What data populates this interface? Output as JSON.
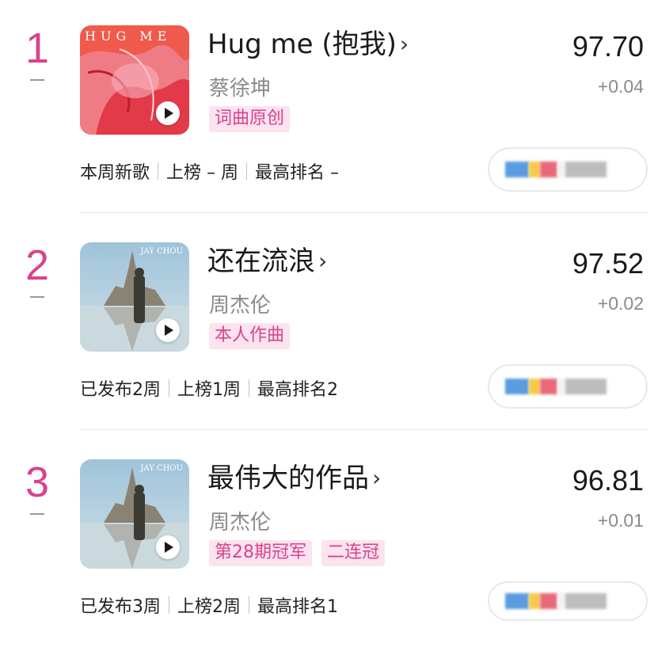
{
  "entries": [
    {
      "rank": "1",
      "title": "Hug me (抱我)",
      "artist": "蔡徐坤",
      "tags": [
        "词曲原创"
      ],
      "score": "97.70",
      "delta": "+0.04",
      "meta": [
        "本周新歌",
        "上榜 – 周",
        "最高排名 –"
      ],
      "cover_text": "HUG ME",
      "cover_icon": "hug-me-cover-art"
    },
    {
      "rank": "2",
      "title": "还在流浪",
      "artist": "周杰伦",
      "tags": [
        "本人作曲"
      ],
      "score": "97.52",
      "delta": "+0.02",
      "meta": [
        "已发布2周",
        "上榜1周",
        "最高排名2"
      ],
      "cover_text": "JAY CHOU",
      "cover_icon": "greatest-works-cover-art"
    },
    {
      "rank": "3",
      "title": "最伟大的作品",
      "artist": "周杰伦",
      "tags": [
        "第28期冠军",
        "二连冠"
      ],
      "score": "96.81",
      "delta": "+0.01",
      "meta": [
        "已发布3周",
        "上榜2周",
        "最高排名1"
      ],
      "cover_text": "JAY CHOU",
      "cover_icon": "greatest-works-cover-art"
    }
  ],
  "colors": {
    "accent": "#d9428e",
    "tag_bg": "#fbe3ef",
    "muted": "#8a8a8a"
  }
}
